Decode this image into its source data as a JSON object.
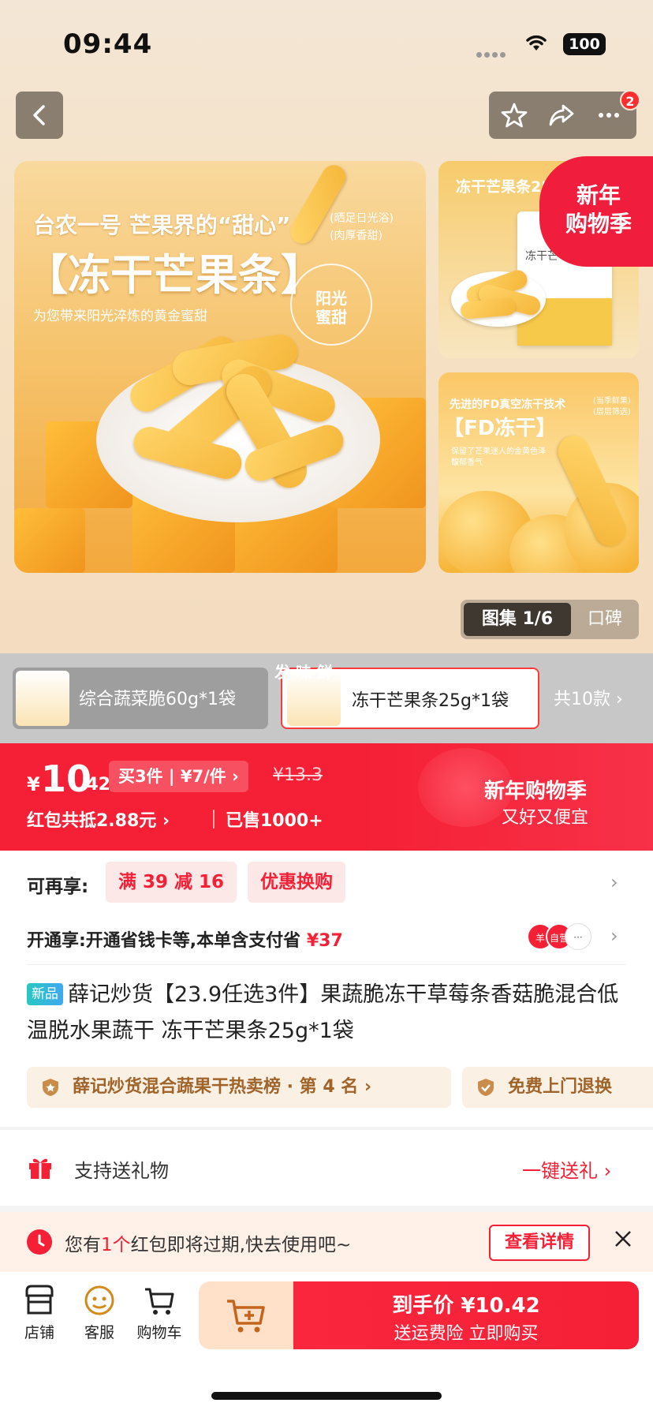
{
  "status_bar": {
    "time": "09:44",
    "battery": "100"
  },
  "top_actions": {
    "badge_count": "2"
  },
  "gallery": {
    "main_line1": "台农一号  芒果界的“甜心”",
    "main_line2": "【冻干芒果条】",
    "main_line3": "为您带来阳光淬炼的黄金蜜甜",
    "main_tag": "(晒足日光浴)\n(肉厚香甜)",
    "main_seal": "阳光\n蜜甜",
    "side1_title": "冻干芒果条25",
    "side1_bag_label": "冻干芒",
    "side2_line1": "先进的FD真空冻干技术",
    "side2_line2": "【FD冻干】",
    "side2_line3": "保留了芒果迷人的金黄色泽\n馥郁香气",
    "side2_tag": "(当季鲜果)\n(层层筛选)",
    "promo_ribbon": "新年\n购物季",
    "counter": "图集 1/6",
    "reviews_tab": "口碑"
  },
  "sku": {
    "items": [
      {
        "label": "综合蔬菜脆60g*1袋"
      },
      {
        "label": "冻干芒果条25g*1袋",
        "overlay": "发  味  鲜"
      }
    ],
    "more": "共10款 ›"
  },
  "price": {
    "currency": "¥",
    "integer": "10",
    "decimal": ".42",
    "multi_buy": "买3件 | ¥7/件 ›",
    "original": "¥13.3",
    "red_packet": "红包共抵2.88元 ›",
    "sold": "已售1000+",
    "festival_title": "新年购物季",
    "festival_sub": "又好又便宜"
  },
  "benefits": {
    "label": "可再享:",
    "chips": [
      "满 39 减 16",
      "优惠换购"
    ],
    "open_prefix": "开通享:开通省钱卡等,本单含支付省 ",
    "open_amount": "¥37",
    "open_icon1": "羊",
    "open_icon2": "自营"
  },
  "product": {
    "new_tag": "新品",
    "title": "薛记炒货【23.9任选3件】果蔬脆冻干草莓条香菇脆混合低温脱水果蔬干 冻干芒果条25g*1袋",
    "rank": "薛记炒货混合蔬果干热卖榜 · 第 4 名 ›",
    "return": "免费上门退换"
  },
  "gift": {
    "label": "支持送礼物",
    "action": "一键送礼 ›"
  },
  "notice": {
    "prefix": "您有",
    "count": "1个",
    "suffix": "红包即将过期,快去使用吧~",
    "button": "查看详情"
  },
  "bottom_bar": {
    "nav": [
      "店铺",
      "客服",
      "购物车"
    ],
    "buy_line1": "到手价 ¥10.42",
    "buy_line2": "送运费险 立即购买"
  },
  "colors": {
    "accent": "#f52035",
    "gold": "#a0632a"
  }
}
